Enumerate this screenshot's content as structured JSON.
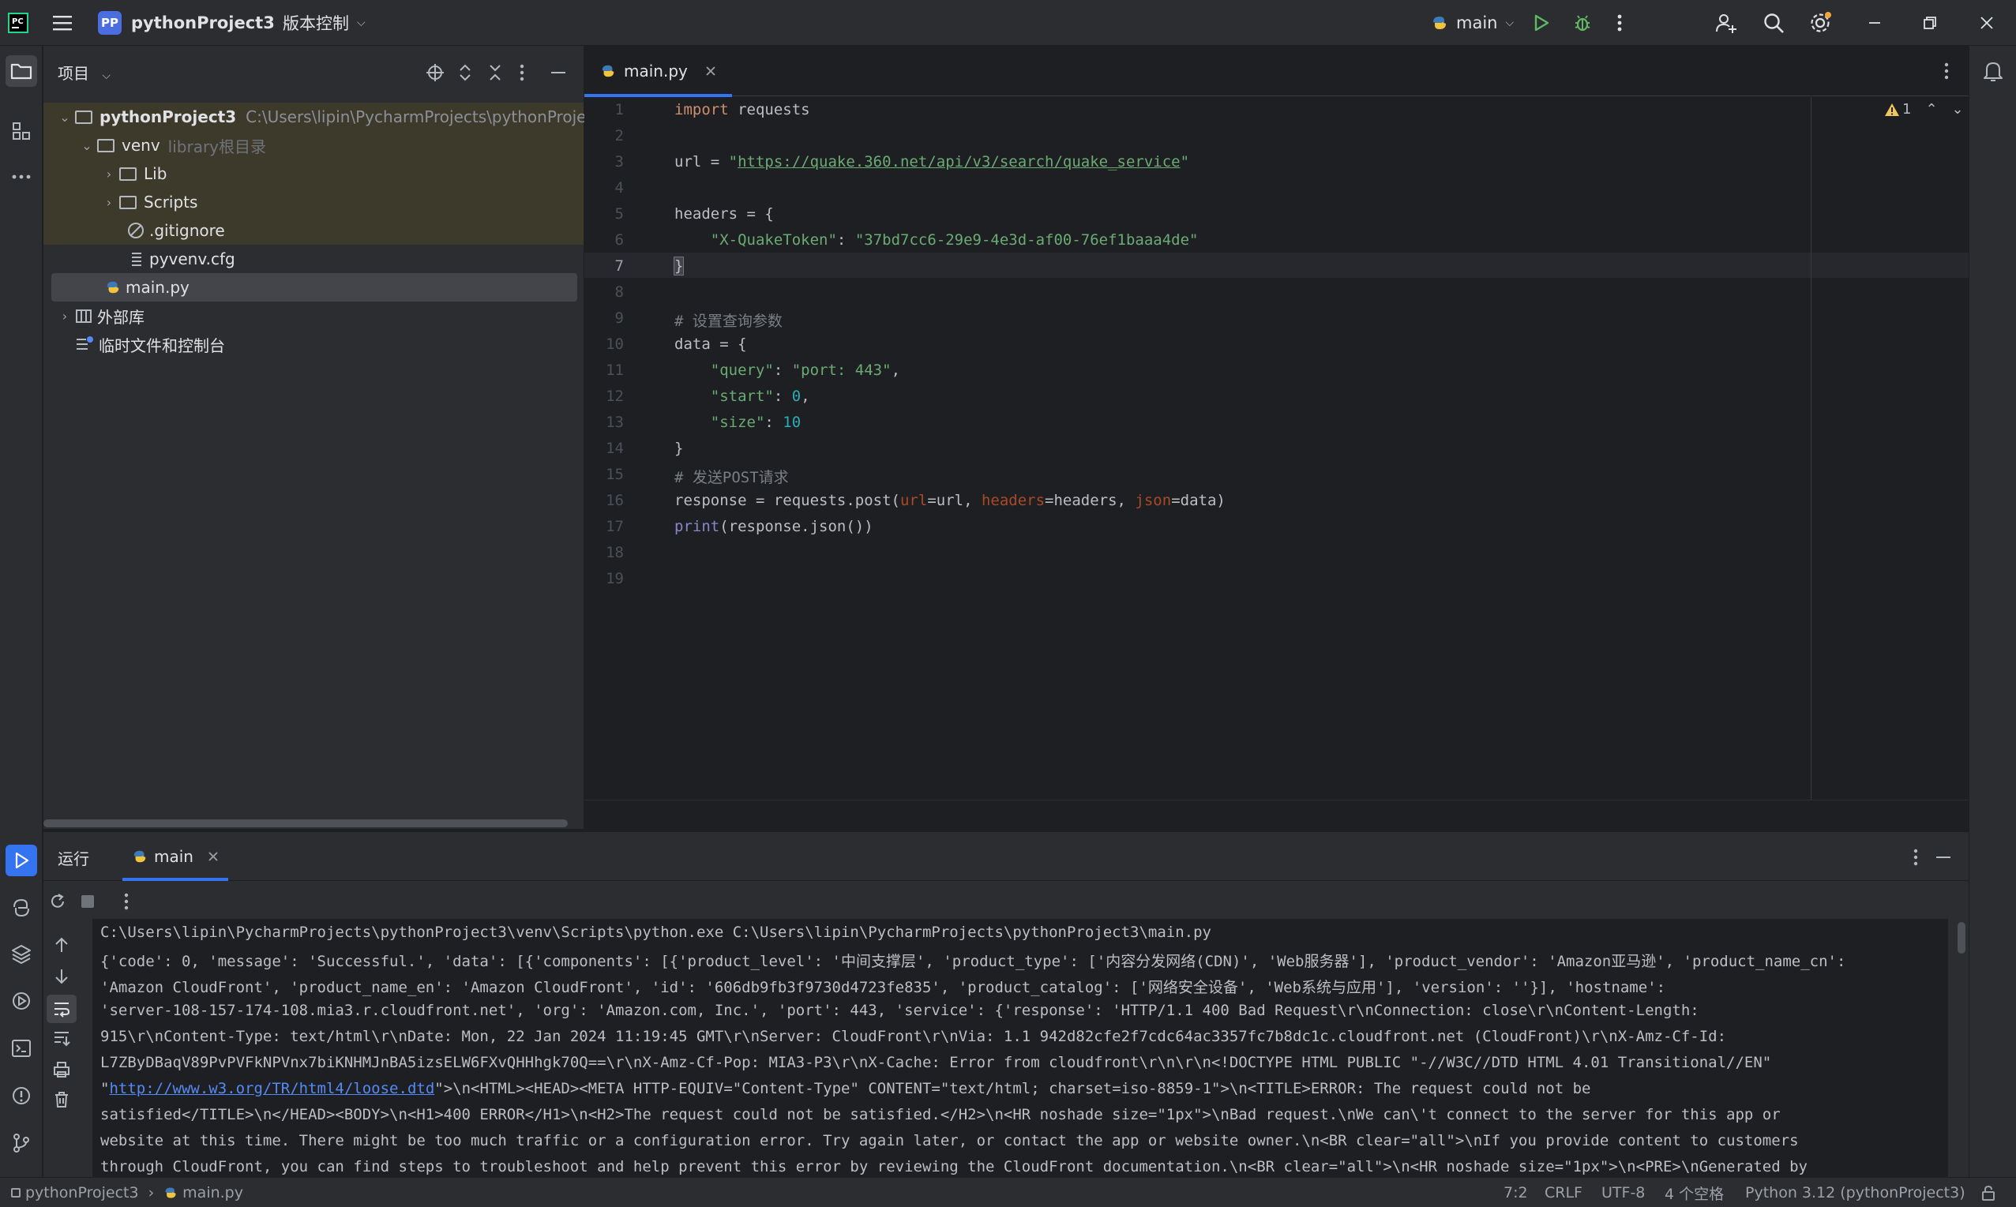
{
  "titlebar": {
    "project_badge": "PP",
    "project_name": "pythonProject3",
    "vcs_label": "版本控制",
    "run_config": "main"
  },
  "project_panel": {
    "title": "项目",
    "tree": [
      {
        "label": "pythonProject3",
        "path": "C:\\Users\\lipin\\PycharmProjects\\pythonProject3"
      },
      {
        "label": "venv",
        "hint": "library根目录"
      },
      {
        "label": "Lib"
      },
      {
        "label": "Scripts"
      },
      {
        "label": ".gitignore"
      },
      {
        "label": "pyvenv.cfg"
      },
      {
        "label": "main.py"
      },
      {
        "label": "外部库"
      },
      {
        "label": "临时文件和控制台"
      }
    ]
  },
  "editor": {
    "tab_label": "main.py",
    "warning_count": "1",
    "line_numbers": [
      "1",
      "2",
      "3",
      "4",
      "5",
      "6",
      "7",
      "8",
      "9",
      "10",
      "11",
      "12",
      "13",
      "14",
      "15",
      "16",
      "17",
      "18",
      "19"
    ],
    "code": {
      "l1_kw": "import",
      "l1_rest": " requests",
      "l3_a": "url = ",
      "l3_q1": "\"",
      "l3_url": "https://quake.360.net/api/v3/search/quake_service",
      "l3_q2": "\"",
      "l5": "headers = {",
      "l6_key": "\"X-QuakeToken\"",
      "l6_sep": ": ",
      "l6_val": "\"37bd7cc6-29e9-4e3d-af00-76ef1baaa4de\"",
      "l7": "}",
      "l9": "# 设置查询参数",
      "l10": "data = {",
      "l11_key": "\"query\"",
      "l11_sep": ": ",
      "l11_val": "\"port: 443\"",
      "l11_end": ",",
      "l12_key": "\"start\"",
      "l12_sep": ": ",
      "l12_val": "0",
      "l12_end": ",",
      "l13_key": "\"size\"",
      "l13_sep": ": ",
      "l13_val": "10",
      "l14": "}",
      "l15": "# 发送POST请求",
      "l16_a": "response = requests.post(",
      "l16_p1": "url",
      "l16_b": "=url, ",
      "l16_p2": "headers",
      "l16_c": "=headers, ",
      "l16_p3": "json",
      "l16_d": "=data)",
      "l17_fn": "print",
      "l17_rest": "(response.json())"
    }
  },
  "run_panel": {
    "tab_run": "运行",
    "tab_main": "main",
    "console": {
      "line1": "C:\\Users\\lipin\\PycharmProjects\\pythonProject3\\venv\\Scripts\\python.exe C:\\Users\\lipin\\PycharmProjects\\pythonProject3\\main.py",
      "line2": "{'code': 0, 'message': 'Successful.', 'data': [{'components': [{'product_level': '中间支撑层', 'product_type': ['内容分发网络(CDN)', 'Web服务器'], 'product_vendor': 'Amazon亚马逊', 'product_name_cn':",
      "line3": "'Amazon CloudFront', 'product_name_en': 'Amazon CloudFront', 'id': '606db9fb3f9730d4723fe835', 'product_catalog': ['网络安全设备', 'Web系统与应用'], 'version': ''}], 'hostname':",
      "line4": "'server-108-157-174-108.mia3.r.cloudfront.net', 'org': 'Amazon.com, Inc.', 'port': 443, 'service': {'response': 'HTTP/1.1 400 Bad Request\\r\\nConnection: close\\r\\nContent-Length:",
      "line5": "915\\r\\nContent-Type: text/html\\r\\nDate: Mon, 22 Jan 2024 11:19:45 GMT\\r\\nServer: CloudFront\\r\\nVia: 1.1 942d82cfe2f7cdc64ac3357fc7b8dc1c.cloudfront.net (CloudFront)\\r\\nX-Amz-Cf-Id:",
      "line6": "L7ZByDBaqV89PvPVFkNPVnx7biKNHMJnBA5izsELW6FXvQHHhgk70Q==\\r\\nX-Amz-Cf-Pop: MIA3-P3\\r\\nX-Cache: Error from cloudfront\\r\\n\\r\\n<!DOCTYPE HTML PUBLIC \"-//W3C//DTD HTML 4.01 Transitional//EN\"",
      "line7_q": "\"",
      "line7_link": "http://www.w3.org/TR/html4/loose.dtd",
      "line7_rest": "\">\\n<HTML><HEAD><META HTTP-EQUIV=\"Content-Type\" CONTENT=\"text/html; charset=iso-8859-1\">\\n<TITLE>ERROR: The request could not be",
      "line8": "satisfied</TITLE>\\n</HEAD><BODY>\\n<H1>400 ERROR</H1>\\n<H2>The request could not be satisfied.</H2>\\n<HR noshade size=\"1px\">\\nBad request.\\nWe can\\'t connect to the server for this app or",
      "line9": "website at this time. There might be too much traffic or a configuration error. Try again later, or contact the app or website owner.\\n<BR clear=\"all\">\\nIf you provide content to customers",
      "line10": "through CloudFront, you can find steps to troubleshoot and help prevent this error by reviewing the CloudFront documentation.\\n<BR clear=\"all\">\\n<HR noshade size=\"1px\">\\n<PRE>\\nGenerated by"
    }
  },
  "statusbar": {
    "crumb_project": "pythonProject3",
    "crumb_file": "main.py",
    "position": "7:2",
    "line_sep": "CRLF",
    "encoding": "UTF-8",
    "indent": "4 个空格",
    "interpreter": "Python 3.12 (pythonProject3)"
  },
  "colors": {
    "accent": "#3574f0",
    "run_green": "#5fb865",
    "panel_bg": "#2b2d30",
    "editor_bg": "#1e1f22"
  }
}
